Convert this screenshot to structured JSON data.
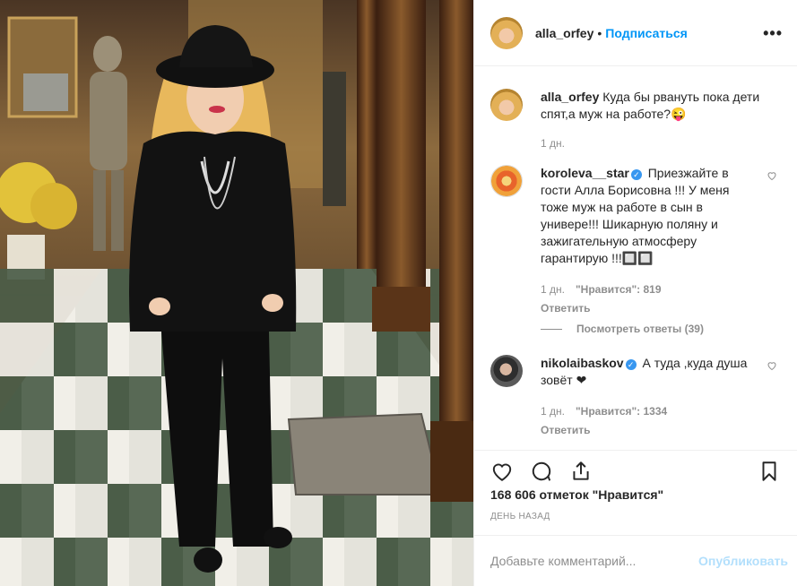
{
  "post": {
    "author": "alla_orfey",
    "separator": "•",
    "follow_label": "Подписаться",
    "more_label": "•••",
    "caption": {
      "username": "alla_orfey",
      "text": "Куда бы рвануть пока дети спят,а муж на работе?😜",
      "time": "1 дн."
    },
    "comments": [
      {
        "username": "koroleva__star",
        "verified": true,
        "text": "Приезжайте в гости Алла Борисовна !!! У меня тоже муж на работе в сын в универе!!! Шикарную поляну и зажигательную атмосферу гарантирую !!!🔲🔲",
        "time": "1 дн.",
        "likes": "\"Нравится\": 819",
        "reply_label": "Ответить",
        "view_replies": "Посмотреть ответы (39)"
      },
      {
        "username": "nikolaibaskov",
        "verified": true,
        "text": "А туда ,куда душа зовёт ❤",
        "time": "1 дн.",
        "likes": "\"Нравится\": 1334",
        "reply_label": "Ответить"
      }
    ],
    "likes_total": "168 606 отметок \"Нравится\"",
    "date": "ДЕНЬ НАЗАД",
    "comment_placeholder": "Добавьте комментарий...",
    "publish_label": "Опубликовать"
  },
  "colors": {
    "accent": "#0095f6",
    "verified": "#3897f0",
    "muted": "#8e8e8e",
    "publish_disabled": "#b2dffc"
  },
  "icons": [
    "more-options-icon",
    "verified-icon",
    "heart-icon",
    "comment-icon",
    "share-icon",
    "bookmark-icon"
  ]
}
